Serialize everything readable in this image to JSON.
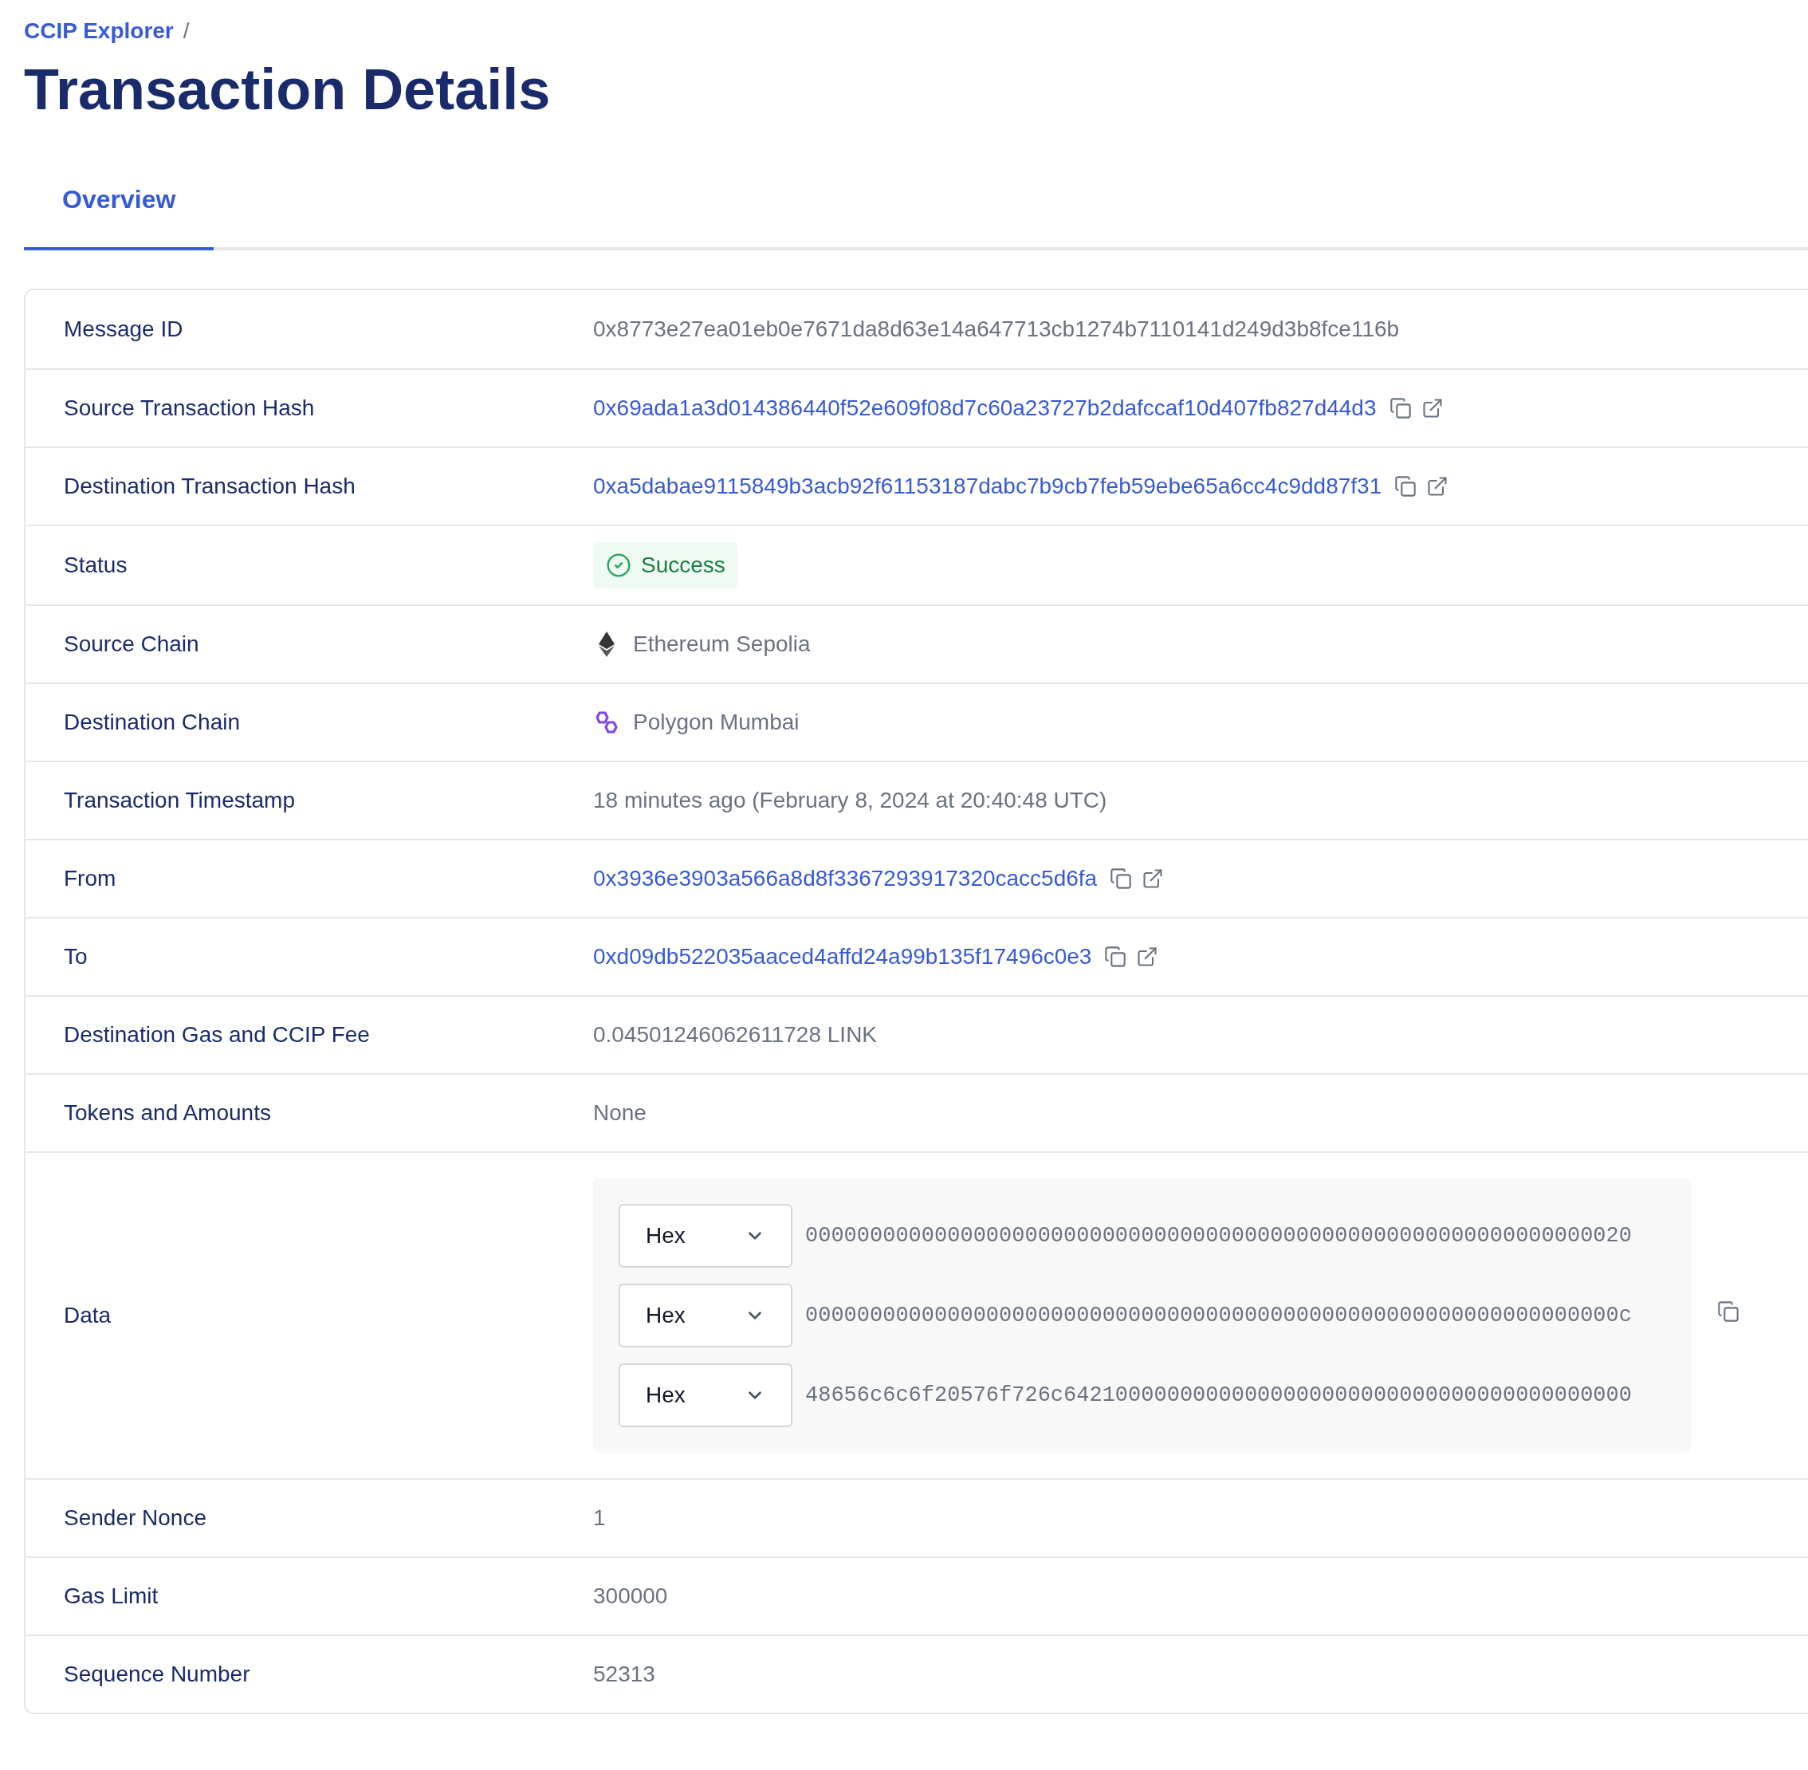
{
  "breadcrumb": {
    "link": "CCIP Explorer",
    "separator": "/"
  },
  "title": "Transaction Details",
  "tabs": [
    {
      "label": "Overview",
      "selected": true
    }
  ],
  "rows": [
    {
      "label": "Message ID",
      "kind": "text",
      "value": "0x8773e27ea01eb0e7671da8d63e14a647713cb1274b7110141d249d3b8fce116b"
    },
    {
      "label": "Source Transaction Hash",
      "kind": "link",
      "value": "0x69ada1a3d014386440f52e609f08d7c60a23727b2dafccaf10d407fb827d44d3"
    },
    {
      "label": "Destination Transaction Hash",
      "kind": "link",
      "value": "0xa5dabae9115849b3acb92f61153187dabc7b9cb7feb59ebe65a6cc4c9dd87f31"
    },
    {
      "label": "Status",
      "kind": "status",
      "value": "Success"
    },
    {
      "label": "Source Chain",
      "kind": "ethereum",
      "value": "Ethereum Sepolia"
    },
    {
      "label": "Destination Chain",
      "kind": "polygon",
      "value": "Polygon Mumbai"
    },
    {
      "label": "Transaction Timestamp",
      "kind": "text",
      "value": "18 minutes ago (February 8, 2024 at 20:40:48 UTC)"
    },
    {
      "label": "From",
      "kind": "link",
      "value": "0x3936e3903a566a8d8f3367293917320cacc5d6fa"
    },
    {
      "label": "To",
      "kind": "link",
      "value": "0xd09db522035aaced4affd24a99b135f17496c0e3"
    },
    {
      "label": "Destination Gas and CCIP Fee",
      "kind": "text",
      "value": "0.04501246062611728 LINK"
    },
    {
      "label": "Tokens and Amounts",
      "kind": "text",
      "value": "None"
    },
    {
      "label": "Data",
      "kind": "data",
      "lines": [
        {
          "format": "Hex",
          "value": "0000000000000000000000000000000000000000000000000000000000000020"
        },
        {
          "format": "Hex",
          "value": "000000000000000000000000000000000000000000000000000000000000000c"
        },
        {
          "format": "Hex",
          "value": "48656c6c6f20576f726c64210000000000000000000000000000000000000000"
        }
      ]
    },
    {
      "label": "Sender Nonce",
      "kind": "text",
      "value": "1"
    },
    {
      "label": "Gas Limit",
      "kind": "text",
      "value": "300000"
    },
    {
      "label": "Sequence Number",
      "kind": "text",
      "value": "52313"
    }
  ]
}
